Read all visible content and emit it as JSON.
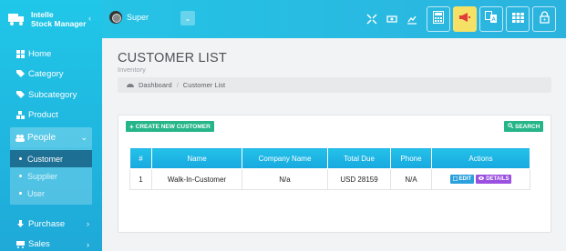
{
  "brand": {
    "line1": "Intelle",
    "line2": "Stock Manager",
    "collapse": "‹"
  },
  "user": {
    "name": "Super",
    "dropdown": "⌄"
  },
  "sidebar": {
    "items": [
      {
        "label": "Home",
        "icon": "home-icon"
      },
      {
        "label": "Category",
        "icon": "tag-icon"
      },
      {
        "label": "Subcategory",
        "icon": "tags-icon"
      },
      {
        "label": "Product",
        "icon": "cubes-icon"
      },
      {
        "label": "People",
        "icon": "users-icon"
      }
    ],
    "people_children": [
      "Customer",
      "Supplier",
      "User"
    ],
    "bottom": [
      {
        "label": "Purchase",
        "icon": "download-icon"
      },
      {
        "label": "Sales",
        "icon": "cart-icon"
      }
    ]
  },
  "page": {
    "title": "CUSTOMER LIST",
    "subtitle": "Inventory"
  },
  "breadcrumb": {
    "home": "Dashboard",
    "sep": "/",
    "current": "Customer List"
  },
  "actions": {
    "create": "CREATE NEW CUSTOMER",
    "search": "SEARCH"
  },
  "table": {
    "headers": [
      "#",
      "Name",
      "Company Name",
      "Total Due",
      "Phone",
      "Actions"
    ],
    "rows": [
      {
        "num": "1",
        "name": "Walk-In-Customer",
        "company": "N/a",
        "due": "USD 28159",
        "phone": "N/A",
        "edit": "EDIT",
        "details": "DETAILS"
      }
    ]
  },
  "colors": {
    "sidebar": "#20c7e8",
    "green": "#25b589",
    "edit": "#2aa0dd",
    "details": "#9b51e0",
    "alert": "#f5e166"
  }
}
